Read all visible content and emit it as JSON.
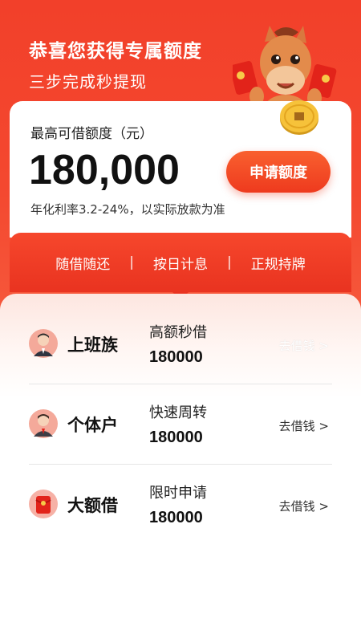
{
  "hero": {
    "title": "恭喜您获得专属额度",
    "subtitle": "三步完成秒提现"
  },
  "quota_card": {
    "label": "最高可借额度（元）",
    "amount": "180,000",
    "rate": "年化利率3.2-24%，以实际放款为准",
    "apply_button": "申请额度"
  },
  "features": [
    "随借随还",
    "按日计息",
    "正规持牌"
  ],
  "products": [
    {
      "name": "上班族",
      "tag": "高额秒借",
      "amount": "180000",
      "action": "去借钱 >",
      "icon": "office-worker-avatar-icon"
    },
    {
      "name": "个体户",
      "tag": "快速周转",
      "amount": "180000",
      "action": "去借钱 >",
      "icon": "business-owner-avatar-icon"
    },
    {
      "name": "大额借",
      "tag": "限时申请",
      "amount": "180000",
      "action": "去借钱 >",
      "icon": "red-envelope-icon"
    }
  ],
  "colors": {
    "brand": "#f2402a",
    "accent": "#ee3a1e"
  }
}
